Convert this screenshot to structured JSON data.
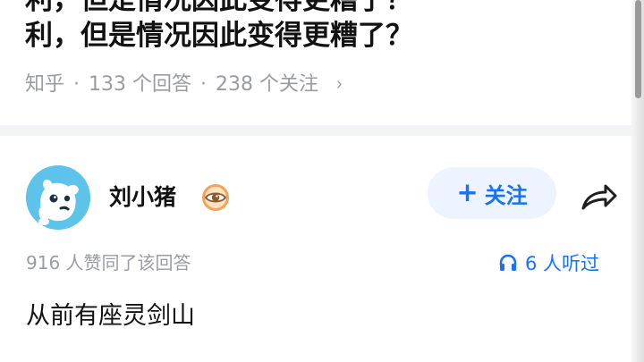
{
  "question": {
    "title_line_1_partial": "利，但是情况因此变得更糟了？",
    "title_line_1": "利，但是情况因此变得更糟了？",
    "title_line_2": "利，但是情况因此变得更糟了？",
    "meta": {
      "source": "知乎",
      "answer_count": "133 个回答",
      "follow_count": "238 个关注",
      "chevron": "›"
    }
  },
  "answer": {
    "author": "刘小猪",
    "follow_button": {
      "plus": "+",
      "label": "关注"
    },
    "stats_text": "916 人赞同了该回答",
    "listeners": "6 人听过",
    "content": "从前有座灵剑山"
  },
  "icons": {
    "avatar": "dog-avatar-icon",
    "badge": "eye-badge-icon",
    "share": "share-icon",
    "listen": "headphone-icon"
  },
  "colors": {
    "accent": "#1772f6",
    "follow_bg": "#edf4ff",
    "meta_text": "#9a9ca2",
    "avatar": "#5ec3ea",
    "badge": "#f0b56a"
  }
}
